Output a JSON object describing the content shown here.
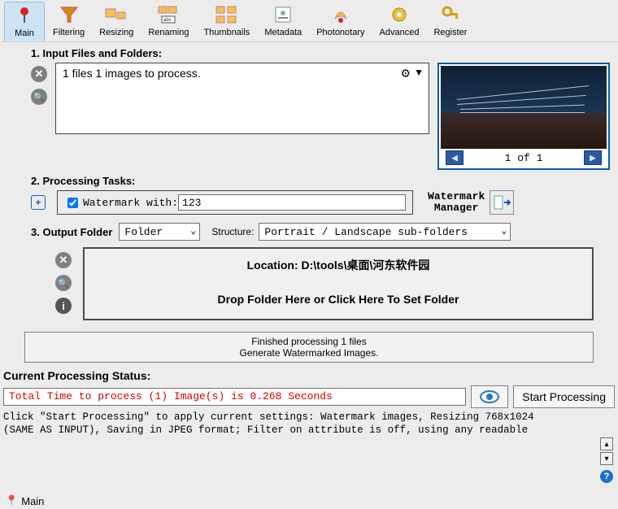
{
  "toolbar": {
    "tabs": [
      {
        "label": "Main",
        "active": true
      },
      {
        "label": "Filtering"
      },
      {
        "label": "Resizing"
      },
      {
        "label": "Renaming"
      },
      {
        "label": "Thumbnails"
      },
      {
        "label": "Metadata"
      },
      {
        "label": "Photonotary"
      },
      {
        "label": "Advanced"
      },
      {
        "label": "Register"
      }
    ]
  },
  "sections": {
    "input_title": "1. Input Files and Folders:",
    "tasks_title": "2. Processing Tasks:",
    "output_title": "3. Output Folder"
  },
  "input": {
    "summary": "1 files 1 images to process."
  },
  "preview": {
    "pager": "1  of  1"
  },
  "tasks": {
    "watermark_label": "Watermark with:",
    "watermark_value": "123",
    "watermark_checked": true,
    "manager_line1": "Watermark",
    "manager_line2": "Manager"
  },
  "output": {
    "folder_select": "Folder",
    "structure_label": "Structure:",
    "structure_select": "Portrait / Landscape sub-folders",
    "location_label": "Location:  D:\\tools\\桌面\\河东软件园",
    "dropzone_hint": "Drop Folder Here or Click Here To Set Folder"
  },
  "status": {
    "line1": "Finished processing 1 files",
    "line2": "Generate Watermarked Images."
  },
  "cps": {
    "title": "Current Processing Status:",
    "time_line": "Total Time to process (1) Image(s) is 0.268 Seconds",
    "start_label": "Start Processing",
    "log_line1": "Click \"Start Processing\" to apply current settings: Watermark images, Resizing 768x1024",
    "log_line2": "(SAME AS INPUT), Saving in JPEG format; Filter on attribute is off, using any readable"
  },
  "footer": {
    "main_label": "Main"
  }
}
